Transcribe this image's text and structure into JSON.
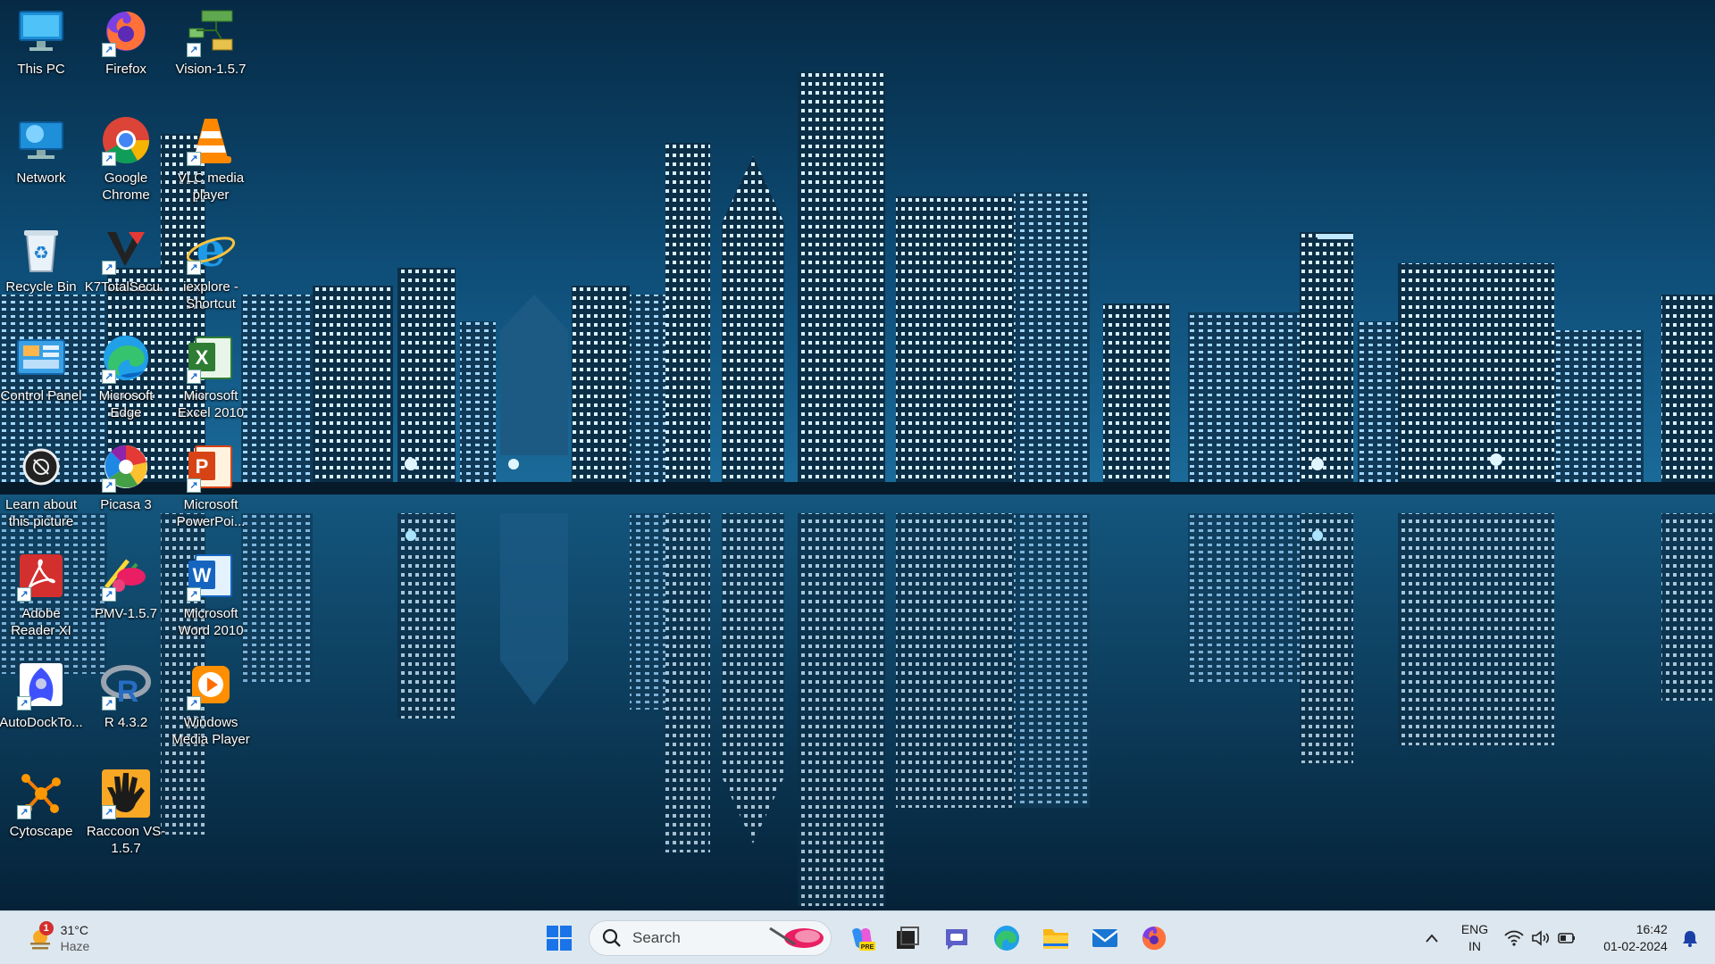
{
  "desktop": {
    "icons": [
      {
        "label": "This PC",
        "icon": "computer-icon"
      },
      {
        "label": "Firefox",
        "icon": "firefox-icon"
      },
      {
        "label": "Vision-1.5.7",
        "icon": "vision-network-icon"
      },
      {
        "label": "Network",
        "icon": "network-icon"
      },
      {
        "label": "Google Chrome",
        "icon": "chrome-icon"
      },
      {
        "label": "VLC media player",
        "icon": "vlc-cone-icon"
      },
      {
        "label": "Recycle Bin",
        "icon": "recycle-bin-icon"
      },
      {
        "label": "K7TotalSecu...",
        "icon": "k7-security-icon"
      },
      {
        "label": "iexplore - Shortcut",
        "icon": "internet-explorer-icon"
      },
      {
        "label": "Control Panel",
        "icon": "control-panel-icon"
      },
      {
        "label": "Microsoft Edge",
        "icon": "edge-icon"
      },
      {
        "label": "Microsoft Excel 2010",
        "icon": "excel-icon"
      },
      {
        "label": "Learn about this picture",
        "icon": "camera-icon"
      },
      {
        "label": "Picasa 3",
        "icon": "picasa-icon"
      },
      {
        "label": "Microsoft PowerPoi...",
        "icon": "powerpoint-icon"
      },
      {
        "label": "Adobe Reader XI",
        "icon": "adobe-reader-icon"
      },
      {
        "label": "PMV-1.5.7",
        "icon": "pmv-molecule-icon"
      },
      {
        "label": "Microsoft Word 2010",
        "icon": "word-icon"
      },
      {
        "label": "AutoDockTo...",
        "icon": "autodock-icon"
      },
      {
        "label": "R 4.3.2",
        "icon": "r-language-icon"
      },
      {
        "label": "Windows Media Player",
        "icon": "media-player-icon"
      },
      {
        "label": "Cytoscape",
        "icon": "cytoscape-icon"
      },
      {
        "label": "Raccoon VS-1.5.7",
        "icon": "raccoon-hand-icon"
      }
    ]
  },
  "taskbar": {
    "weather": {
      "temp": "31°C",
      "condition": "Haze",
      "badge": "1"
    },
    "search": {
      "placeholder": "Search"
    },
    "pinned": [
      {
        "name": "start-button",
        "icon": "windows-logo-icon"
      },
      {
        "name": "copilot-button",
        "icon": "copilot-icon"
      },
      {
        "name": "task-view-button",
        "icon": "task-view-icon"
      },
      {
        "name": "chat-button",
        "icon": "chat-icon"
      },
      {
        "name": "edge-button",
        "icon": "edge-icon"
      },
      {
        "name": "file-explorer-button",
        "icon": "folder-icon"
      },
      {
        "name": "mail-button",
        "icon": "mail-icon"
      },
      {
        "name": "firefox-button",
        "icon": "firefox-icon"
      }
    ],
    "tray": {
      "language_line1": "ENG",
      "language_line2": "IN",
      "time": "16:42",
      "date": "01-02-2024"
    }
  },
  "colors": {
    "taskbar_bg": "#dde7ef",
    "wallpaper_sky": "#0b4266",
    "wallpaper_water": "#062338",
    "accent": "#1a73e8"
  }
}
